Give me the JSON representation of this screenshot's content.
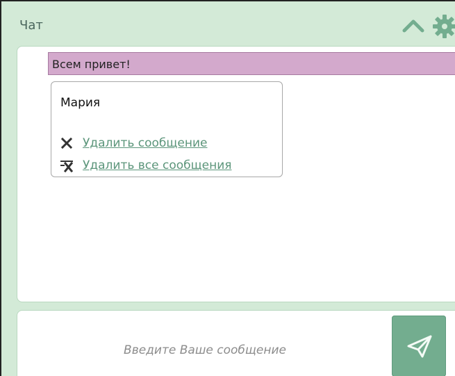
{
  "chat": {
    "title": "Чат",
    "header_icons": {
      "collapse": "chevron-up-icon",
      "settings": "gear-icon"
    },
    "messages": [
      {
        "text": "Всем привет!"
      }
    ],
    "context_menu": {
      "user": "Мария",
      "items": [
        {
          "icon": "close-icon",
          "label": "Удалить сообщение"
        },
        {
          "icon": "delete-all-icon",
          "label": "Удалить все сообщения"
        }
      ]
    },
    "input": {
      "placeholder": "Введите Ваше сообщение",
      "value": ""
    },
    "send_icon": "send-icon"
  },
  "colors": {
    "background": "#d3ead7",
    "message_highlight": "#d3a9cc",
    "accent": "#73ad8f",
    "link": "#5b957a"
  }
}
